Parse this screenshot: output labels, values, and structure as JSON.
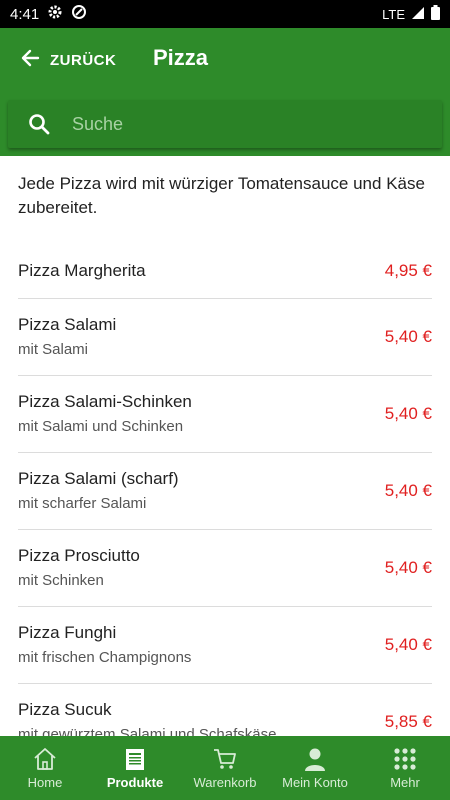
{
  "status_bar": {
    "time": "4:41",
    "network": "LTE"
  },
  "header": {
    "back_label": "ZURÜCK",
    "title": "Pizza"
  },
  "search": {
    "placeholder": "Suche"
  },
  "intro": "Jede Pizza wird mit würziger Tomatensauce und Käse zubereitet.",
  "items": [
    {
      "name": "Pizza Margherita",
      "desc": "",
      "price": "4,95 €"
    },
    {
      "name": "Pizza Salami",
      "desc": "mit Salami",
      "price": "5,40 €"
    },
    {
      "name": "Pizza Salami-Schinken",
      "desc": "mit Salami und Schinken",
      "price": "5,40 €"
    },
    {
      "name": "Pizza Salami (scharf)",
      "desc": "mit scharfer Salami",
      "price": "5,40 €"
    },
    {
      "name": "Pizza Prosciutto",
      "desc": "mit Schinken",
      "price": "5,40 €"
    },
    {
      "name": "Pizza Funghi",
      "desc": "mit frischen Champignons",
      "price": "5,40 €"
    },
    {
      "name": "Pizza Sucuk",
      "desc": "mit gewürztem Salami und Schafskäse",
      "price": "5,85 €"
    }
  ],
  "bottom_nav": [
    {
      "label": "Home",
      "icon": "home-icon"
    },
    {
      "label": "Produkte",
      "icon": "menu-card-icon",
      "active": true
    },
    {
      "label": "Warenkorb",
      "icon": "cart-icon"
    },
    {
      "label": "Mein Konto",
      "icon": "person-icon"
    },
    {
      "label": "Mehr",
      "icon": "grid-dots-icon"
    }
  ],
  "colors": {
    "primary": "#2e8b2a",
    "price": "#e02020",
    "statusbar": "#000000"
  }
}
